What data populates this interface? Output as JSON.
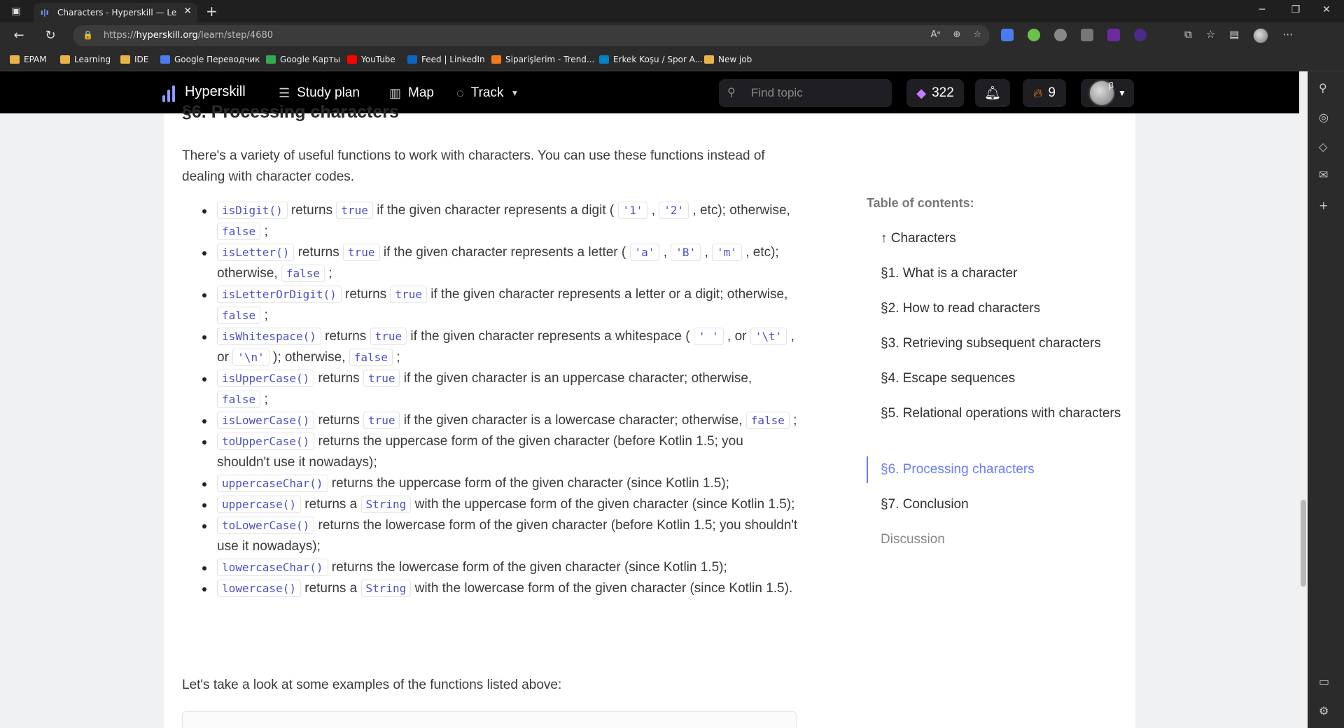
{
  "browser": {
    "tab_title": "Characters - Hyperskill — Learn p",
    "url_prefix": "https://",
    "url_host": "hyperskill.org",
    "url_path": "/learn/step/4680",
    "bookmarks": [
      {
        "label": "EPAM",
        "icon": "folder-icon",
        "color": "#e8b44a"
      },
      {
        "label": "Learning",
        "icon": "folder-icon",
        "color": "#e8b44a"
      },
      {
        "label": "IDE",
        "icon": "folder-icon",
        "color": "#e8b44a"
      },
      {
        "label": "Google Переводчик",
        "icon": "google-translate-icon",
        "color": "#4a7cf0"
      },
      {
        "label": "Google Карты",
        "icon": "google-maps-icon",
        "color": "#34a853"
      },
      {
        "label": "YouTube",
        "icon": "youtube-icon",
        "color": "#ff0000"
      },
      {
        "label": "Feed | LinkedIn",
        "icon": "linkedin-icon",
        "color": "#0a66c2"
      },
      {
        "label": "Siparişlerim - Trend...",
        "icon": "trendyol-icon",
        "color": "#f27a1a"
      },
      {
        "label": "Erkek Koşu / Spor A...",
        "icon": "decathlon-icon",
        "color": "#0082c3"
      },
      {
        "label": "New job",
        "icon": "folder-icon",
        "color": "#e8b44a"
      }
    ]
  },
  "header": {
    "logo": "Hyperskill",
    "nav": [
      {
        "label": "Study plan",
        "icon": "list-icon"
      },
      {
        "label": "Map",
        "icon": "map-icon"
      },
      {
        "label": "Track",
        "icon": "track-icon"
      }
    ],
    "search_placeholder": "Find topic",
    "gems": "322",
    "streak": "9",
    "avatar_badge": "β",
    "accent": "#6b7bff"
  },
  "article": {
    "section_title": "§6. Processing characters",
    "intro": "There's a variety of useful functions to work with characters. You can use these functions instead of dealing with character codes.",
    "items": [
      {
        "code": "isDigit()",
        "parts": [
          " returns ",
          {
            "code": "true"
          },
          " if the given character represents a digit ( ",
          {
            "code": "'1'"
          },
          " , ",
          {
            "code": "'2'"
          },
          " , etc); otherwise, ",
          {
            "code": "false"
          },
          " ;"
        ]
      },
      {
        "code": "isLetter()",
        "parts": [
          " returns ",
          {
            "code": "true"
          },
          " if the given character represents a letter ( ",
          {
            "code": "'a'"
          },
          " , ",
          {
            "code": "'B'"
          },
          " , ",
          {
            "code": "'m'"
          },
          " , etc); otherwise, ",
          {
            "code": "false"
          },
          " ;"
        ]
      },
      {
        "code": "isLetterOrDigit()",
        "parts": [
          " returns ",
          {
            "code": "true"
          },
          " if the given character represents a letter or a digit; otherwise, ",
          {
            "code": "false"
          },
          " ;"
        ]
      },
      {
        "code": "isWhitespace()",
        "parts": [
          " returns ",
          {
            "code": "true"
          },
          " if the given character represents a whitespace ( ",
          {
            "code": "' '"
          },
          " , or ",
          {
            "code": "'\\t'"
          },
          " , or ",
          {
            "code": "'\\n'"
          },
          " ); otherwise, ",
          {
            "code": "false"
          },
          " ;"
        ]
      },
      {
        "code": "isUpperCase()",
        "parts": [
          " returns ",
          {
            "code": "true"
          },
          " if the given character is an uppercase character; otherwise, ",
          {
            "code": "false"
          },
          " ;"
        ]
      },
      {
        "code": "isLowerCase()",
        "parts": [
          " returns ",
          {
            "code": "true"
          },
          " if the given character is a lowercase character; otherwise, ",
          {
            "code": "false"
          },
          " ;"
        ]
      },
      {
        "code": "toUpperCase()",
        "parts": [
          " returns the uppercase form of the given character (before Kotlin 1.5; you shouldn't use it nowadays);"
        ]
      },
      {
        "code": "uppercaseChar()",
        "parts": [
          " returns the uppercase form of the given character (since Kotlin 1.5);"
        ]
      },
      {
        "code": "uppercase()",
        "parts": [
          " returns a ",
          {
            "code": "String"
          },
          " with the uppercase form of the given character (since Kotlin 1.5);"
        ]
      },
      {
        "code": "toLowerCase()",
        "parts": [
          " returns the lowercase form of the given character (before Kotlin 1.5; you shouldn't use it nowadays);"
        ]
      },
      {
        "code": "lowercaseChar()",
        "parts": [
          " returns the lowercase form of the given character (since Kotlin 1.5);"
        ]
      },
      {
        "code": "lowercase()",
        "parts": [
          " returns a ",
          {
            "code": "String"
          },
          " with the lowercase form of the given character (since Kotlin 1.5)."
        ]
      }
    ],
    "outro": "Let's take a look at some examples of the functions listed above:"
  },
  "toc": {
    "title": "Table of contents:",
    "items": [
      {
        "label": "↑ Characters",
        "state": "normal"
      },
      {
        "label": "§1. What is a character",
        "state": "normal"
      },
      {
        "label": "§2. How to read characters",
        "state": "normal"
      },
      {
        "label": "§3. Retrieving subsequent characters",
        "state": "normal"
      },
      {
        "label": "§4. Escape sequences",
        "state": "normal"
      },
      {
        "label": "§5. Relational operations with characters",
        "state": "normal"
      },
      {
        "label": "§6. Processing characters",
        "state": "active"
      },
      {
        "label": "§7. Conclusion",
        "state": "normal"
      },
      {
        "label": "Discussion",
        "state": "muted"
      }
    ]
  }
}
